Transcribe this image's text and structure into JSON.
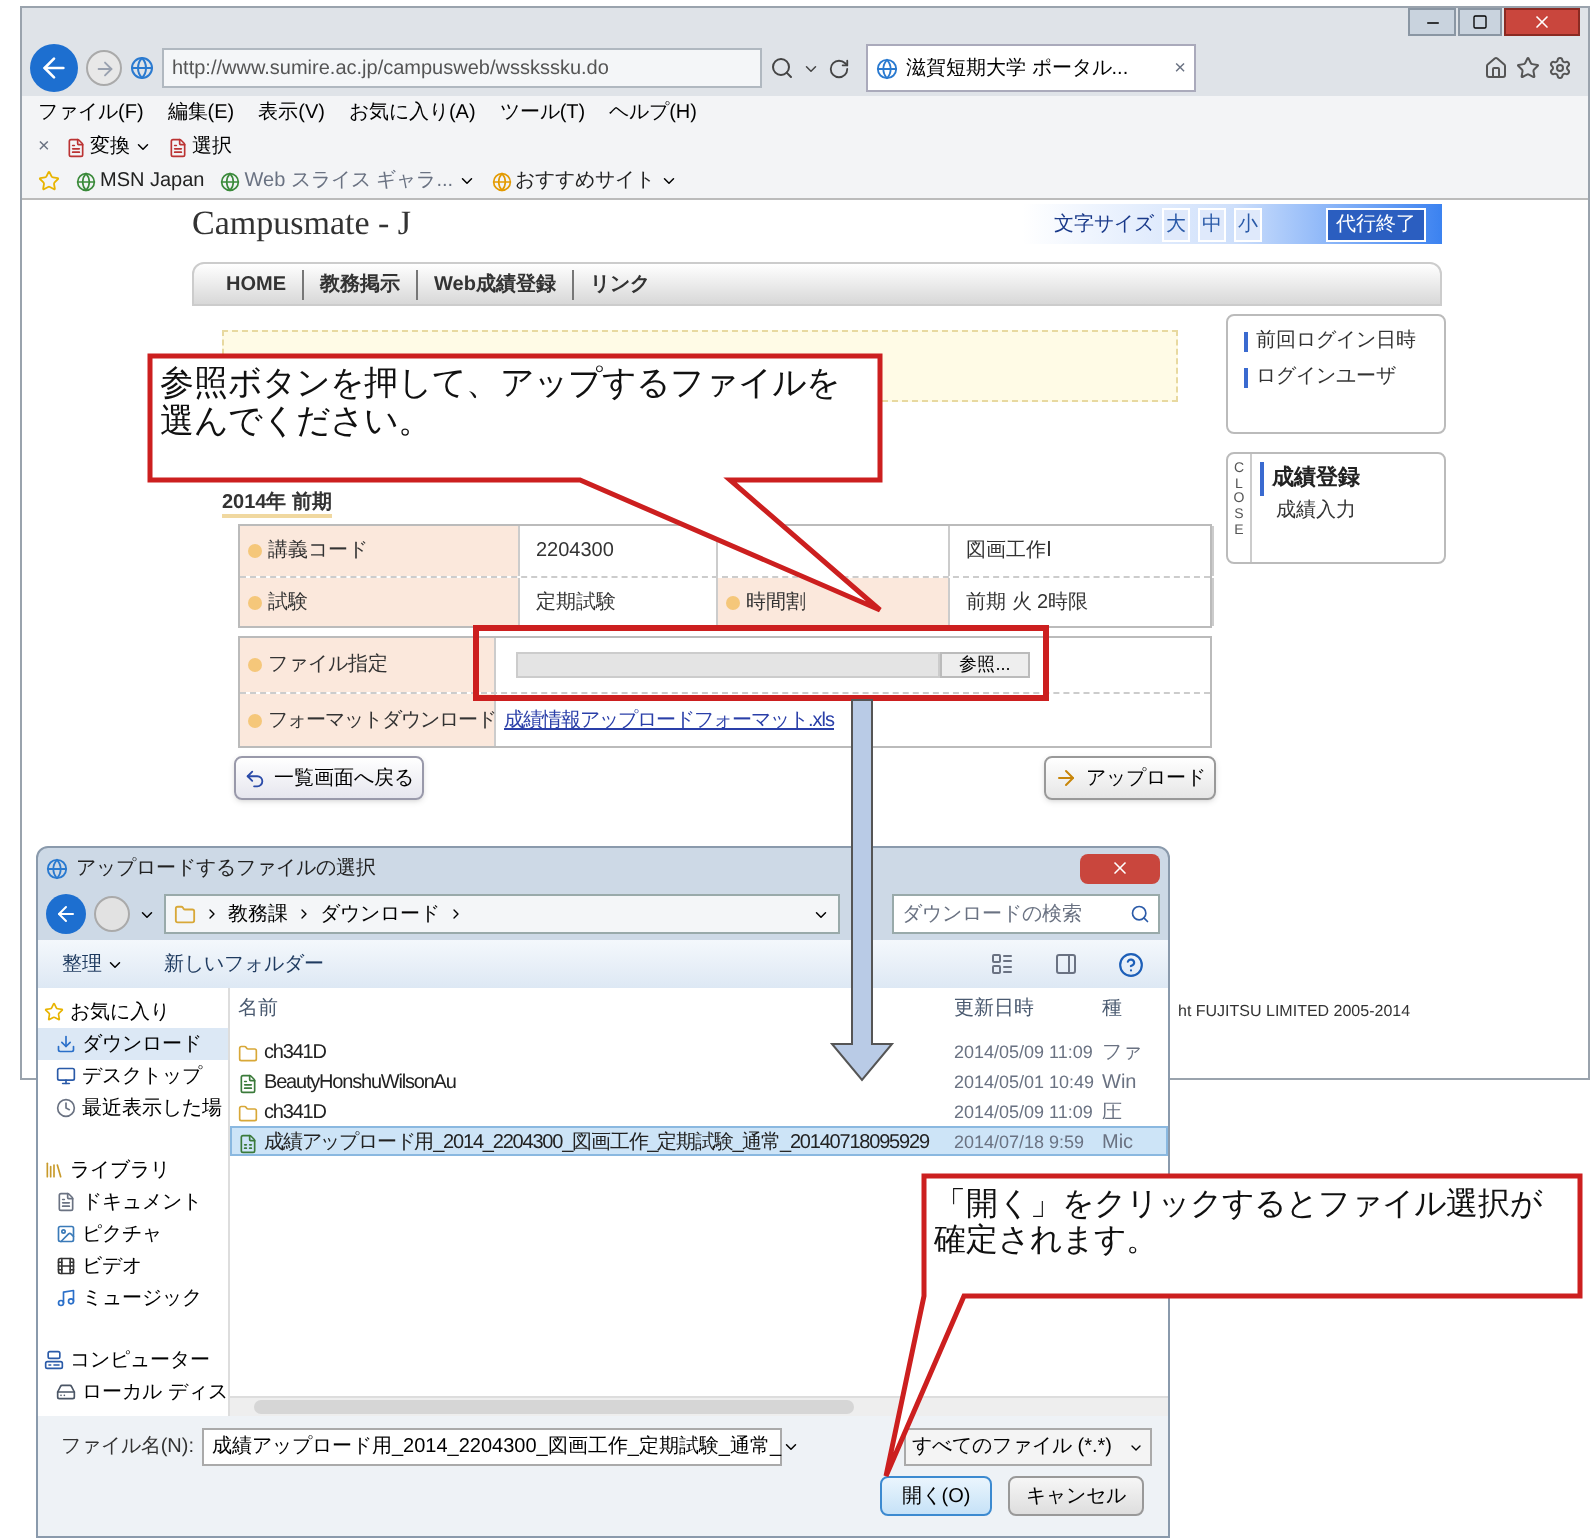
{
  "browser": {
    "address": "http://www.sumire.ac.jp/campusweb/wsskssku.do",
    "tab": "滋賀短期大学 ポータル...",
    "tab_close": "×",
    "menu": [
      "ファイル(F)",
      "編集(E)",
      "表示(V)",
      "お気に入り(A)",
      "ツール(T)",
      "ヘルプ(H)"
    ],
    "command_close": "×",
    "commands": [
      {
        "label": "変換",
        "dropdown": true
      },
      {
        "label": "選択",
        "dropdown": false
      }
    ],
    "favorites": [
      {
        "label": "MSN Japan",
        "dropdown": false
      },
      {
        "label": "Web スライス ギャラ...",
        "dropdown": true
      },
      {
        "label": "おすすめサイト",
        "dropdown": true
      }
    ]
  },
  "portal": {
    "logo": "Campusmate - J",
    "font_size_label": "文字サイズ",
    "font_sizes": [
      "大",
      "中",
      "小"
    ],
    "end_proxy": "代行終了",
    "nav": [
      "HOME",
      "教務掲示",
      "Web成績登録",
      "リンク"
    ],
    "term": "2014年 前期",
    "course_rows": [
      [
        {
          "kind": "label",
          "text": "講義コード"
        },
        {
          "kind": "value",
          "text": "2204300"
        },
        {
          "kind": "blank"
        },
        {
          "kind": "value",
          "text": "図画工作Ⅰ"
        }
      ],
      [
        {
          "kind": "label",
          "text": "試験"
        },
        {
          "kind": "value",
          "text": "定期試験"
        },
        {
          "kind": "label",
          "text": "時間割"
        },
        {
          "kind": "value",
          "text": "前期 火 2時限"
        }
      ]
    ],
    "file_label": "ファイル指定",
    "browse": "参照...",
    "format_label": "フォーマットダウンロード",
    "format_link": "成績情報アップロードフォーマット.xls",
    "back_button": "一覧画面へ戻る",
    "upload_button": "アップロード",
    "info": [
      "前回ログイン日時",
      "ログインユーザ"
    ],
    "menu_close": "CLOSE",
    "menu_title": "成績登録",
    "menu_items": [
      "成績入力"
    ],
    "footer": "ht FUJITSU LIMITED 2005-2014"
  },
  "dialog": {
    "title": "アップロードするファイルの選択",
    "breadcrumb": [
      "教務課",
      "ダウンロード"
    ],
    "search_placeholder": "ダウンロードの検索",
    "toolbar": [
      {
        "label": "整理",
        "dropdown": true
      },
      {
        "label": "新しいフォルダー",
        "dropdown": false
      }
    ],
    "nav": [
      {
        "label": "お気に入り",
        "kind": "group",
        "selected": false
      },
      {
        "label": "ダウンロード",
        "kind": "item",
        "selected": true
      },
      {
        "label": "デスクトップ",
        "kind": "item",
        "selected": false
      },
      {
        "label": "最近表示した場",
        "kind": "item",
        "selected": false
      },
      {
        "label": "ライブラリ",
        "kind": "group",
        "selected": false
      },
      {
        "label": "ドキュメント",
        "kind": "item",
        "selected": false
      },
      {
        "label": "ピクチャ",
        "kind": "item",
        "selected": false
      },
      {
        "label": "ビデオ",
        "kind": "item",
        "selected": false
      },
      {
        "label": "ミュージック",
        "kind": "item",
        "selected": false
      },
      {
        "label": "コンピューター",
        "kind": "group",
        "selected": false
      },
      {
        "label": "ローカル ディス",
        "kind": "item",
        "selected": false
      }
    ],
    "columns": [
      "名前",
      "更新日時",
      "種"
    ],
    "files": [
      {
        "name": "ch341D",
        "modified": "2014/05/09 11:09",
        "type": "ファ",
        "kind": "folder",
        "selected": false
      },
      {
        "name": "BeautyHonshuWilsonAu",
        "modified": "2014/05/01 10:49",
        "type": "Win",
        "kind": "file",
        "selected": false
      },
      {
        "name": "ch341D",
        "modified": "2014/05/09 11:09",
        "type": "圧",
        "kind": "folder",
        "selected": false
      },
      {
        "name": "成績アップロード用_2014_2204300_図画工作_定期試験_通常_20140718095929",
        "modified": "2014/07/18 9:59",
        "type": "Mic",
        "kind": "sheet",
        "selected": true
      }
    ],
    "filename_label": "ファイル名(N):",
    "filename": "成績アップロード用_2014_2204300_図画工作_定期試験_通常_",
    "filter": "すべてのファイル (*.*)",
    "open_button": "開く(O)",
    "cancel_button": "キャンセル"
  },
  "callouts": [
    {
      "text": "参照ボタンを押して、アップするファイルを選んでください。"
    },
    {
      "text": "「開く」をクリックするとファイル選択が確定されます。"
    }
  ]
}
